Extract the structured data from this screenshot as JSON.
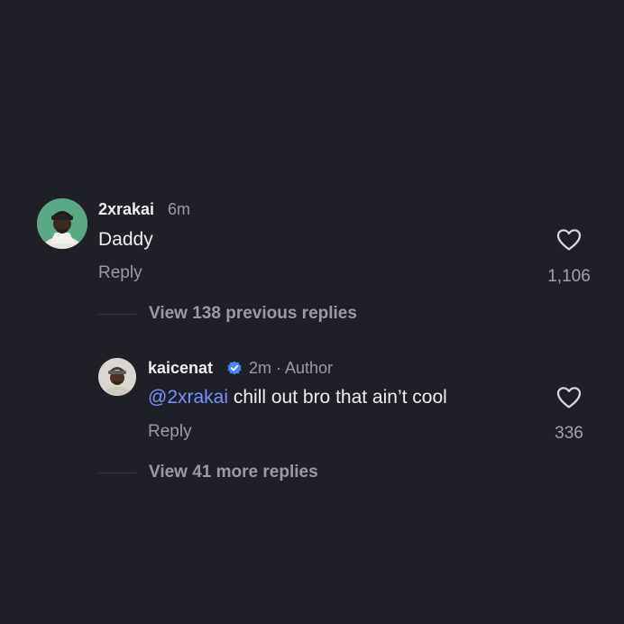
{
  "comments": [
    {
      "username": "2xrakai",
      "time": "6m",
      "text": "Daddy",
      "reply_label": "Reply",
      "likes": "1,106",
      "avatar_icon": "user-avatar-icon",
      "heart_icon": "heart-outline-icon"
    }
  ],
  "replies_toggle_1": {
    "label": "View 138 previous replies"
  },
  "reply": {
    "username": "kaicenat",
    "verified_icon": "verified-badge-icon",
    "meta": "2m · Author",
    "mention": "@2xrakai",
    "text": " chill out bro that ain’t cool",
    "reply_label": "Reply",
    "likes": "336",
    "heart_icon": "heart-outline-icon"
  },
  "replies_toggle_2": {
    "label": "View 41 more replies"
  },
  "colors": {
    "background": "#1f1f27",
    "mention": "#7a92f5",
    "verified": "#3d8af7",
    "secondary_text": "#9a9aa2"
  }
}
